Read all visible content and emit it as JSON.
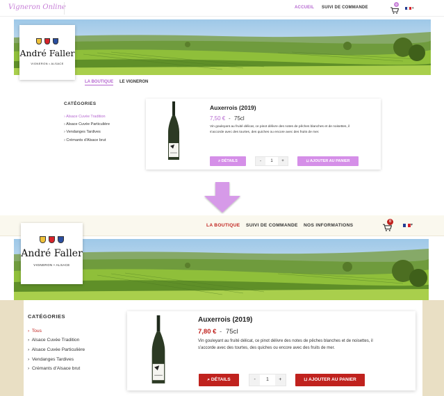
{
  "top": {
    "brand": "Vigneron Online",
    "nav": [
      "ACCUEIL",
      "SUIVI DE COMMANDE"
    ],
    "cart_count": "0",
    "logo": {
      "name": "André Faller",
      "sub": "VIGNERON • ALSACE"
    },
    "tabs": [
      "LA BOUTIQUE",
      "LE VIGNERON"
    ],
    "categories_title": "CATÉGORIES",
    "categories": [
      "Alsace Cuvée Tradition",
      "Alsace Cuvée Particulière",
      "Vendanges Tardives",
      "Crémants d'Alsace brut"
    ],
    "product": {
      "name": "Auxerrois (2019)",
      "price": "7,50 €",
      "sep": "-",
      "volume": "75cl",
      "desc_1": "Vin gouleyant au fruité délicat, ce pinot délivre des notes de pêches blanches et de noisettes, il",
      "desc_2": "s'accorde avec des tourtes, des quiches ou encore avec des fruits de mer.",
      "details": "DÉTAILS",
      "qty": "1",
      "add": "AJOUTER AU PANIER",
      "minus": "-",
      "plus": "+"
    }
  },
  "bottom": {
    "nav": [
      "LA BOUTIQUE",
      "SUIVI DE COMMANDE",
      "NOS INFORMATIONS"
    ],
    "cart_count": "0",
    "logo": {
      "name": "André Faller",
      "sub": "VIGNERON • ALSACE"
    },
    "categories_title": "CATÉGORIES",
    "categories": [
      "Tous",
      "Alsace Cuvée Tradition",
      "Alsace Cuvée Particulière",
      "Vendanges Tardives",
      "Crémants d'Alsace brut"
    ],
    "product": {
      "name": "Auxerrois (2019)",
      "price": "7,80 €",
      "sep": "-",
      "volume": "75cl",
      "desc_1": "Vin gouleyant au fruité délicat, ce pinot délivre des notes de pêches blanches et de noisettes, il",
      "desc_2": "s'accorde avec des tourtes, des quiches ou encore avec des fruits de mer.",
      "details": "DÉTAILS",
      "qty": "1",
      "add": "AJOUTER AU PANIER",
      "minus": "-",
      "plus": "+"
    }
  },
  "colors": {
    "purple": "#b567d0",
    "purple_btn": "#d58fe8",
    "red": "#c0221e",
    "beige": "#e9dfc4",
    "arrow": "#d69ae8"
  },
  "icons": {
    "cart": "shopping-cart-icon",
    "flag": "french-flag-icon",
    "search": "magnifier-icon",
    "arrow": "down-arrow-icon"
  }
}
